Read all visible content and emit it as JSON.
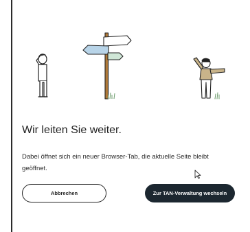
{
  "dialog": {
    "title": "Wir leiten Sie weiter.",
    "message": "Dabei öffnet sich ein neuer Browser-Tab, die aktuelle Seite bleibt geöffnet.",
    "cancel_label": "Abbrechen",
    "confirm_label": "Zur TAN-Verwaltung wechseln"
  },
  "illustration": {
    "icons": [
      "person-hand-on-head-icon",
      "signpost-icon",
      "person-pointing-icon"
    ]
  },
  "colors": {
    "primary_button": "#1c2730",
    "text": "#1f1f1f",
    "sign_blue": "#b8d4e8",
    "sign_green": "#cfe6d6",
    "post": "#b07a3a"
  }
}
